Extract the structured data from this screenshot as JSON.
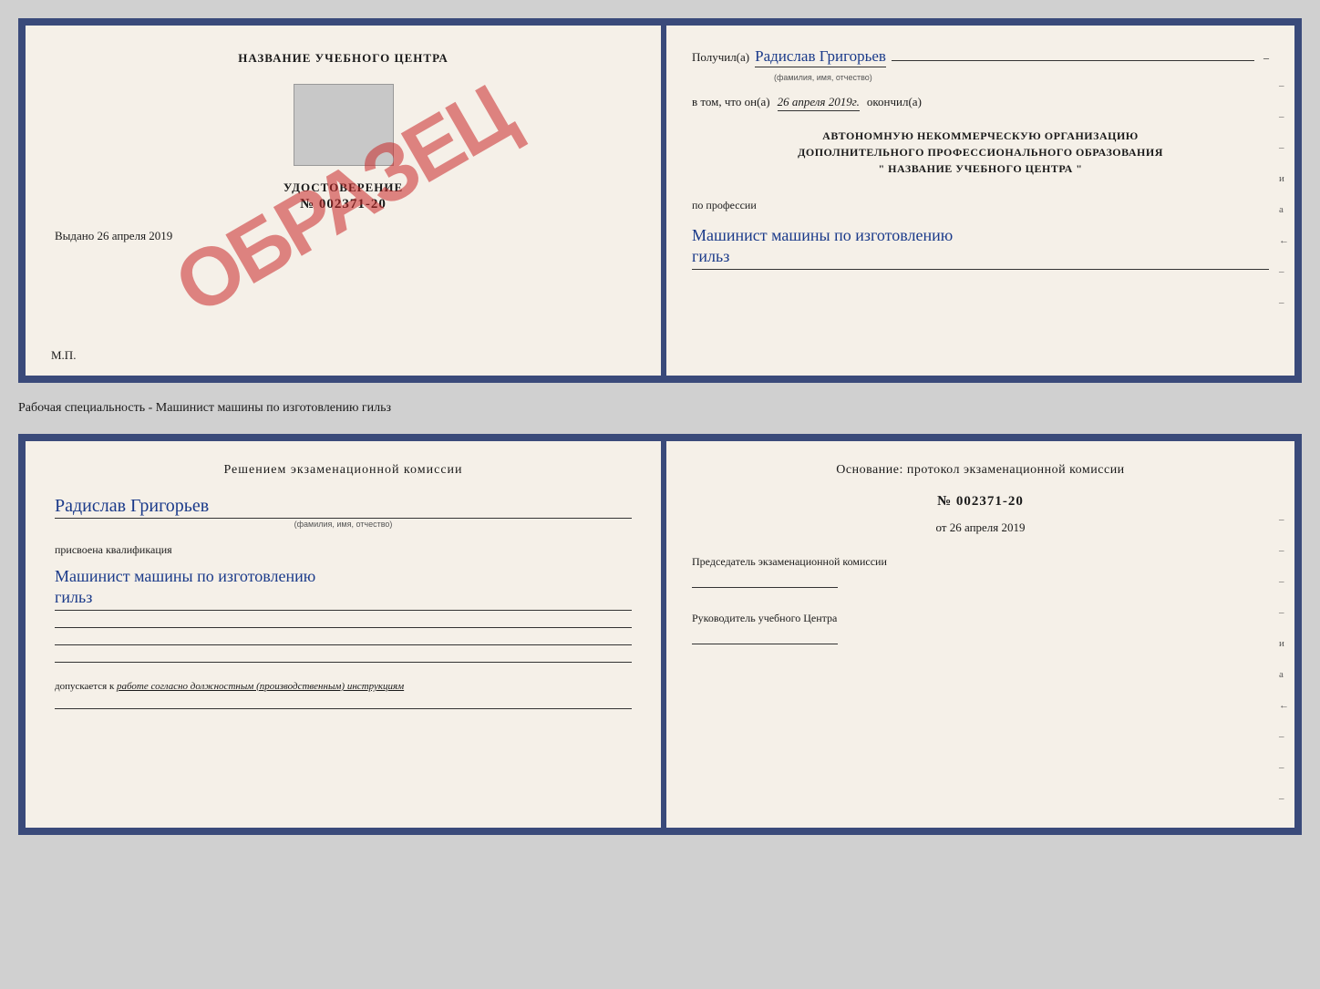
{
  "top_document": {
    "left": {
      "school_name": "НАЗВАНИЕ УЧЕБНОГО ЦЕНТРА",
      "cert_title": "УДОСТОВЕРЕНИЕ",
      "cert_number": "№ 002371-20",
      "issued_label": "Выдано",
      "issued_date": "26 апреля 2019",
      "mp_label": "М.П.",
      "obrazec": "ОБРАЗЕЦ"
    },
    "right": {
      "received_label": "Получил(а)",
      "recipient_name": "Радислав Григорьев",
      "fio_sublabel": "(фамилия, имя, отчество)",
      "date_prefix": "в том, что он(а)",
      "date_value": "26 апреля 2019г.",
      "date_suffix": "окончил(а)",
      "org_line1": "АВТОНОМНУЮ НЕКОММЕРЧЕСКУЮ ОРГАНИЗАЦИЮ",
      "org_line2": "ДОПОЛНИТЕЛЬНОГО ПРОФЕССИОНАЛЬНОГО ОБРАЗОВАНИЯ",
      "org_line3": "\" НАЗВАНИЕ УЧЕБНОГО ЦЕНТРА \"",
      "profession_label": "по профессии",
      "profession_value": "Машинист машины по изготовлению",
      "profession_value2": "гильз",
      "side_marks": [
        "–",
        "–",
        "–",
        "–",
        "и",
        "а",
        "←",
        "–"
      ]
    }
  },
  "subtitle": "Рабочая специальность - Машинист машины по изготовлению гильз",
  "bottom_document": {
    "left": {
      "decision_header": "Решением  экзаменационной  комиссии",
      "person_name": "Радислав Григорьев",
      "fio_sublabel": "(фамилия, имя, отчество)",
      "qual_label": "присвоена квалификация",
      "qual_value": "Машинист машины по изготовлению",
      "qual_value2": "гильз",
      "допуск_prefix": "допускается к",
      "допуск_italic": "работе согласно должностным (производственным) инструкциям"
    },
    "right": {
      "osnov_header": "Основание:  протокол  экзаменационной  комиссии",
      "protocol_number": "№  002371-20",
      "protocol_date_prefix": "от",
      "protocol_date": "26 апреля 2019",
      "chairman_title": "Председатель экзаменационной комиссии",
      "director_title": "Руководитель учебного Центра",
      "side_marks": [
        "–",
        "–",
        "–",
        "–",
        "и",
        "а",
        "←",
        "–",
        "–",
        "–"
      ]
    }
  }
}
